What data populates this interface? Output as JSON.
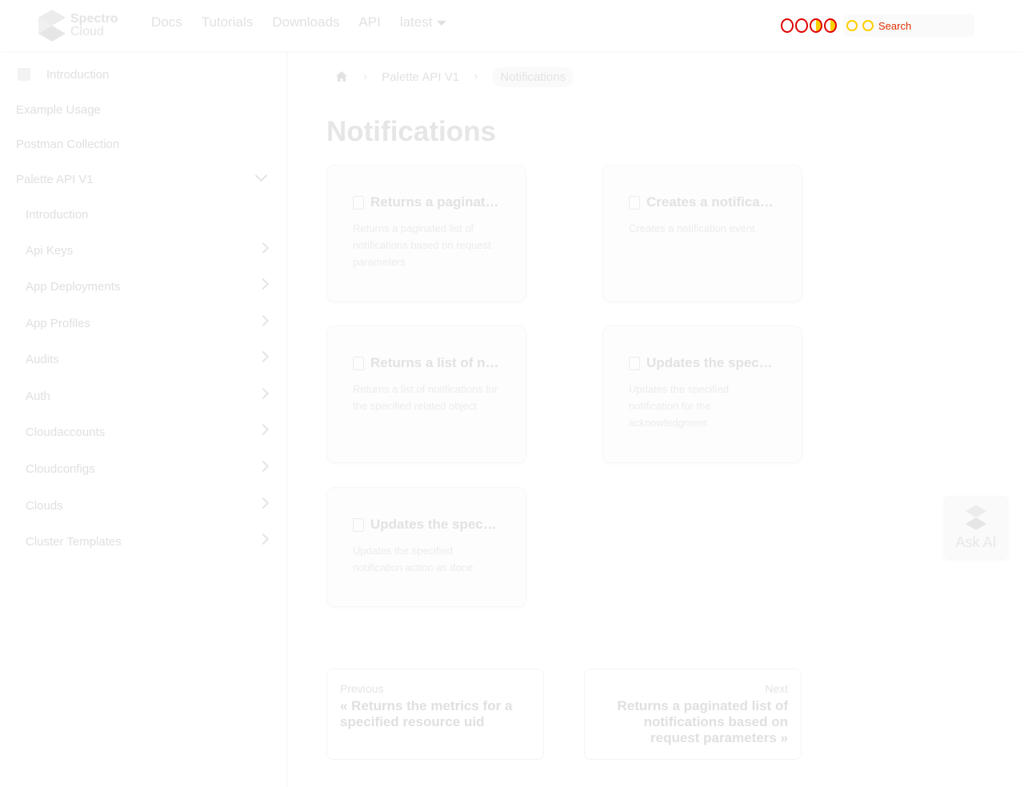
{
  "brand": {
    "line1": "Spectro",
    "line2": "Cloud"
  },
  "nav": {
    "links": [
      "Docs",
      "Tutorials",
      "Downloads",
      "API"
    ],
    "version": "latest",
    "search_placeholder": "Search"
  },
  "sidebar": {
    "top": [
      {
        "label": "Introduction"
      },
      {
        "label": "Example Usage"
      },
      {
        "label": "Postman Collection"
      },
      {
        "label": "Palette API V1"
      }
    ],
    "sub": [
      {
        "label": "Introduction"
      },
      {
        "label": "Api Keys"
      },
      {
        "label": "App Deployments"
      },
      {
        "label": "App Profiles"
      },
      {
        "label": "Audits"
      },
      {
        "label": "Auth"
      },
      {
        "label": "Cloudaccounts"
      },
      {
        "label": "Cloudconfigs"
      },
      {
        "label": "Clouds"
      },
      {
        "label": "Cluster Templates"
      }
    ]
  },
  "breadcrumb": {
    "parent": "Palette API V1",
    "current": "Notifications"
  },
  "page": {
    "title": "Notifications"
  },
  "cards": [
    {
      "title": "Returns a paginate…",
      "desc": "Returns a paginated list of notifications based on request parameters"
    },
    {
      "title": "Creates a notificati…",
      "desc": "Creates a notification event"
    },
    {
      "title": "Returns a list of noti…",
      "desc": "Returns a list of notifications for the specified related object"
    },
    {
      "title": "Updates the speci…",
      "desc": "Updates the specified notification for the acknowledgment"
    },
    {
      "title": "Updates the speci…",
      "desc": "Updates the specified notification action as done"
    }
  ],
  "pager": {
    "prev_sub": "Previous",
    "prev_label": "« Returns the metrics for a specified resource uid",
    "next_sub": "Next",
    "next_label": "Returns a paginated list of notifications based on request parameters »"
  },
  "ask_ai": {
    "label": "Ask AI"
  }
}
